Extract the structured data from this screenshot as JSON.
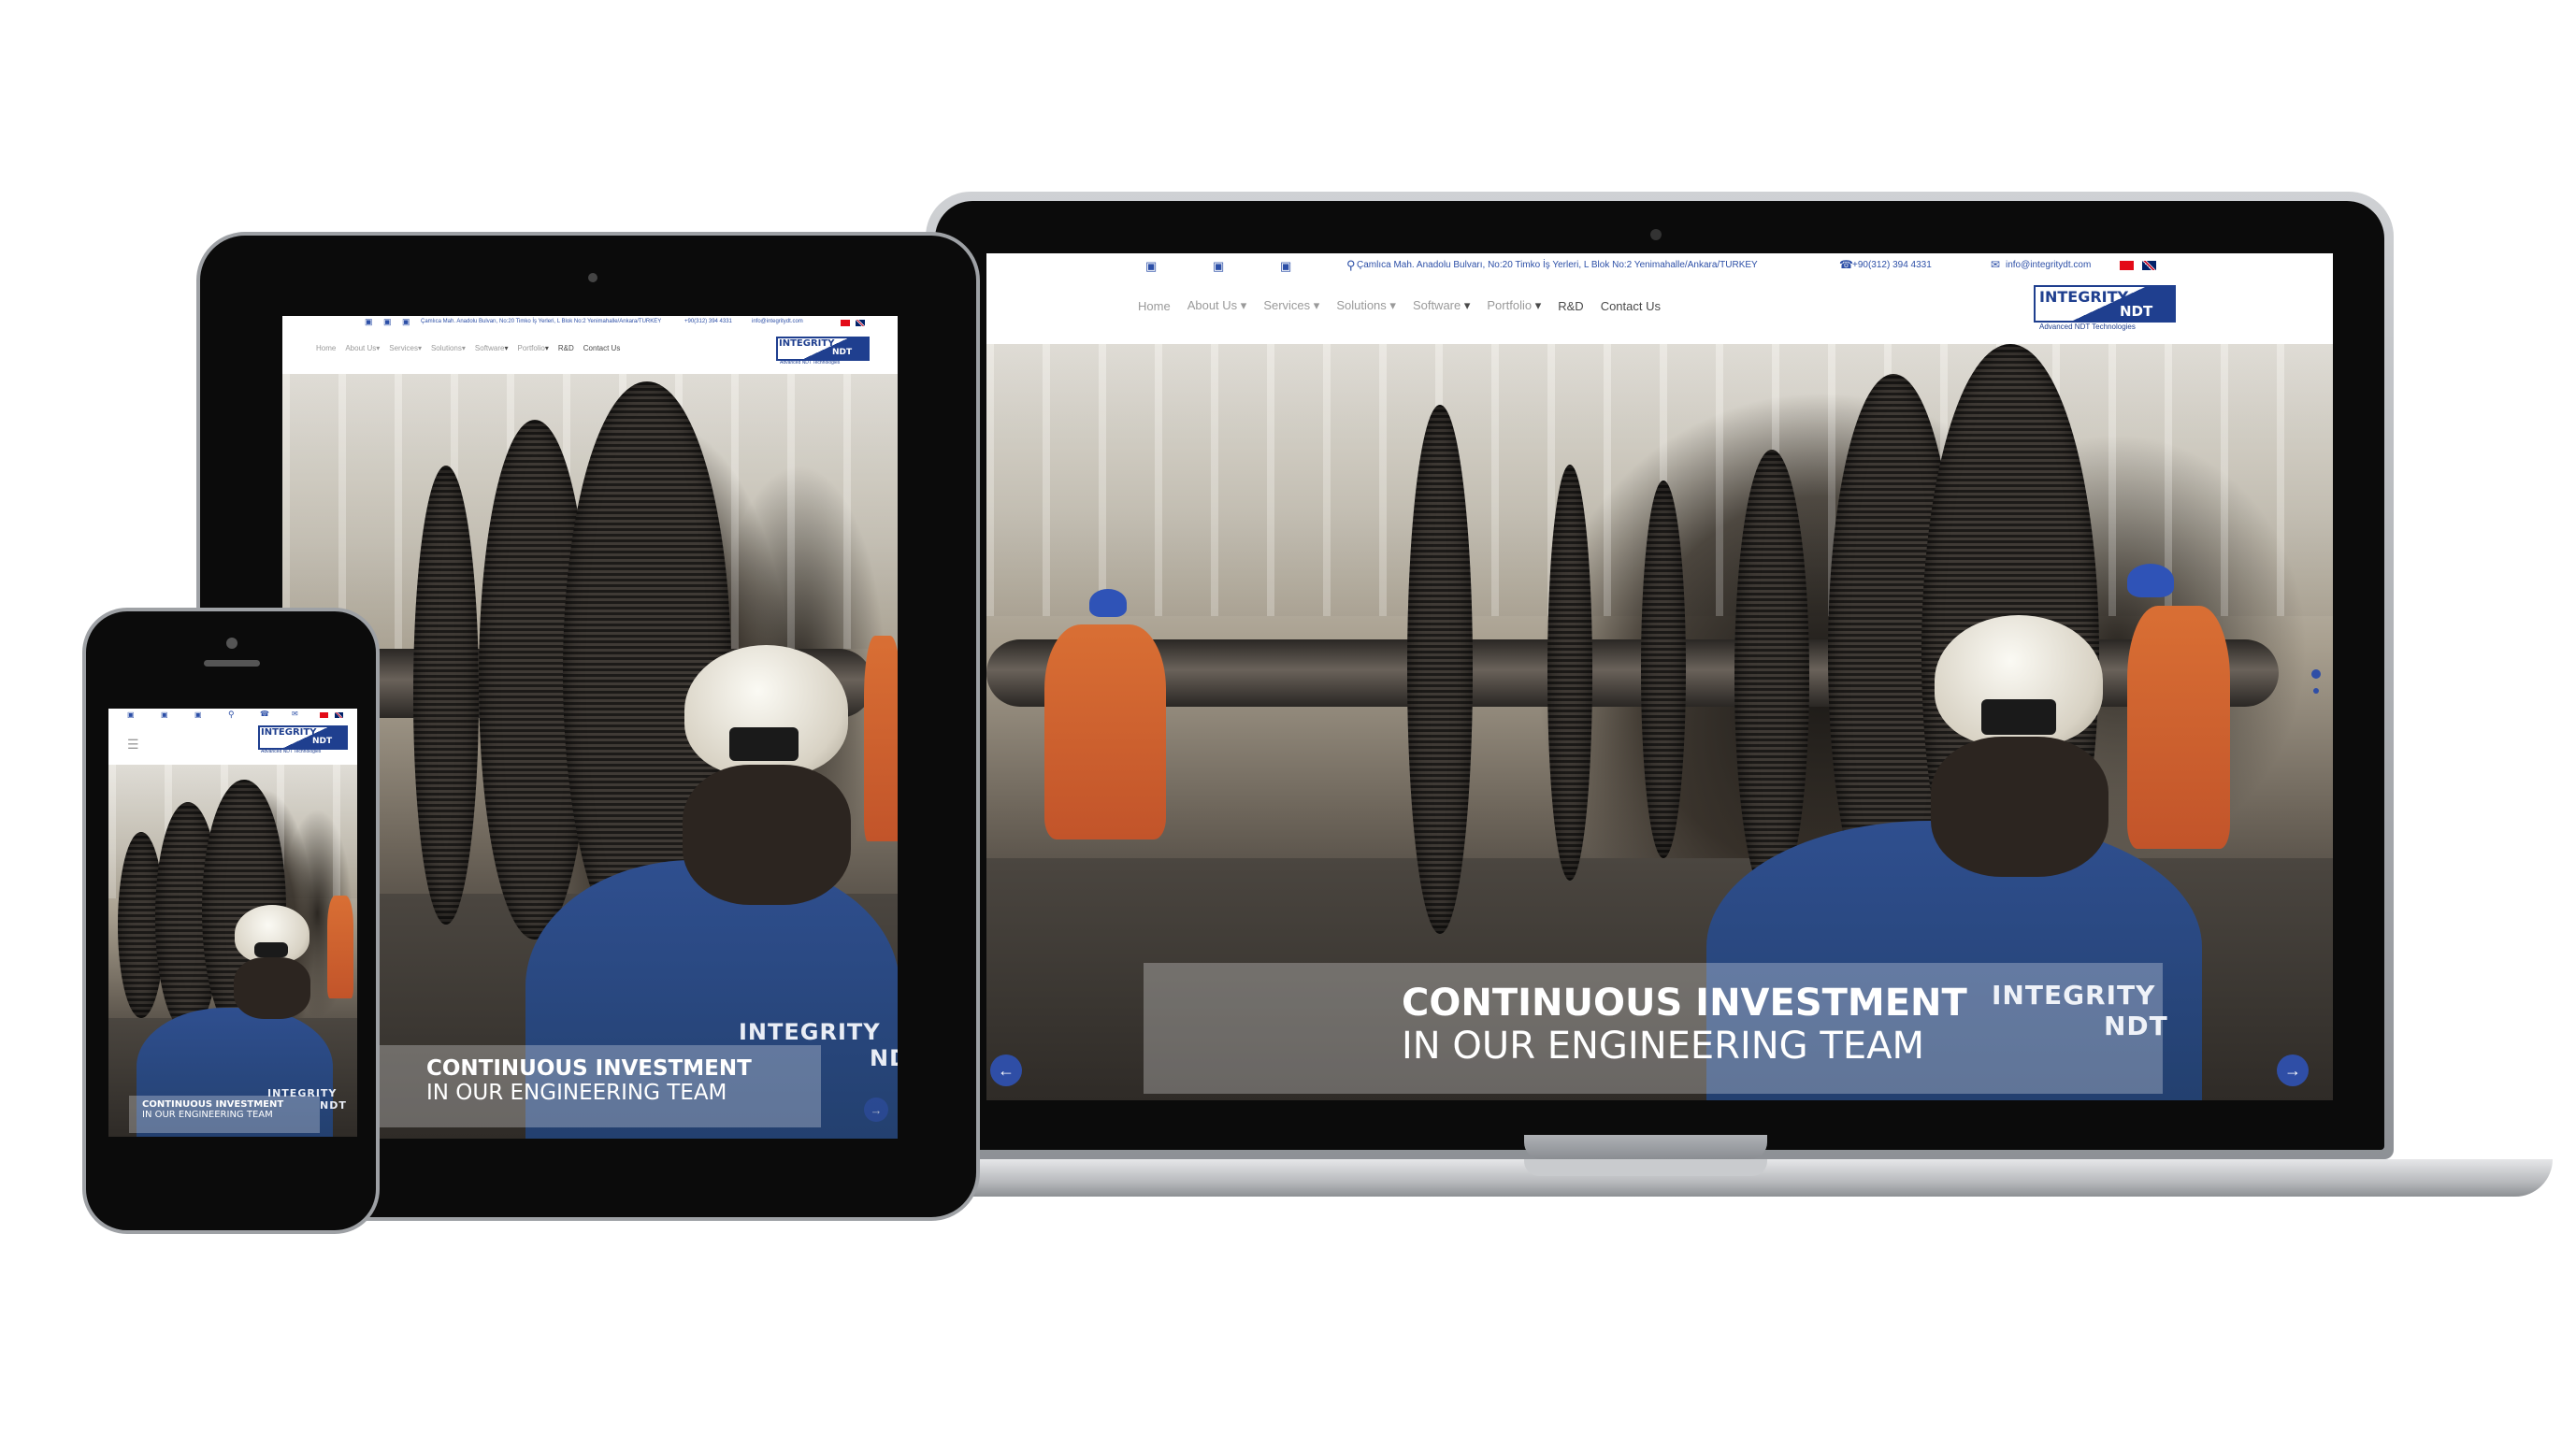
{
  "site": {
    "topbar": {
      "address": "Çamlıca Mah. Anadolu Bulvarı, No:20 Timko İş Yerleri, L Blok No:2 Yenimahalle/Ankara/TURKEY",
      "phone": "+90(312) 394 4331",
      "email": "info@integritydt.com"
    },
    "menu": [
      "Home",
      "About Us",
      "Services",
      "Solutions",
      "Software",
      "Portfolio",
      "R&D",
      "Contact Us"
    ],
    "logo": {
      "line1": "INTEGRITY",
      "line2": "NDT",
      "tagline": "Advanced NDT Technologies"
    },
    "hero": {
      "headline": "CONTINUOUS INVESTMENT",
      "subline": "IN OUR ENGINEERING TEAM",
      "jacket_logo_1": "INTEGRITY",
      "jacket_logo_2": "NDT"
    },
    "icons": [
      "facebook-icon",
      "linkedin-icon",
      "youtube-icon",
      "location-pin-icon",
      "phone-icon",
      "mail-icon",
      "turkish-flag-icon",
      "uk-flag-icon",
      "hamburger-menu-icon",
      "prev-arrow-icon",
      "next-arrow-icon"
    ],
    "brand_color": "#1f3f8f",
    "link_color": "#2c4fa7"
  }
}
